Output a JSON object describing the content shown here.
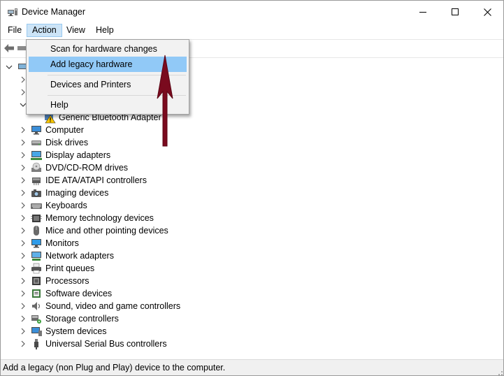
{
  "window": {
    "title": "Device Manager",
    "controls": {
      "minimize": "minimize",
      "maximize": "maximize",
      "close": "close"
    }
  },
  "menubar": {
    "items": [
      {
        "label": "File"
      },
      {
        "label": "Action"
      },
      {
        "label": "View"
      },
      {
        "label": "Help"
      }
    ],
    "active": "Action"
  },
  "action_menu": {
    "items": [
      {
        "label": "Scan for hardware changes"
      },
      {
        "label": "Add legacy hardware",
        "highlighted": true
      },
      {
        "label": "Devices and Printers"
      },
      {
        "label": "Help"
      }
    ]
  },
  "tree": {
    "expanded_child": {
      "label": "Generic Bluetooth Adapter",
      "icon": "warning-icon"
    },
    "categories": [
      {
        "label": "Computer",
        "icon": "computer-icon"
      },
      {
        "label": "Disk drives",
        "icon": "disk-drive-icon"
      },
      {
        "label": "Display adapters",
        "icon": "display-adapter-icon"
      },
      {
        "label": "DVD/CD-ROM drives",
        "icon": "dvd-drive-icon"
      },
      {
        "label": "IDE ATA/ATAPI controllers",
        "icon": "ide-controller-icon"
      },
      {
        "label": "Imaging devices",
        "icon": "camera-icon"
      },
      {
        "label": "Keyboards",
        "icon": "keyboard-icon"
      },
      {
        "label": "Memory technology devices",
        "icon": "memory-icon"
      },
      {
        "label": "Mice and other pointing devices",
        "icon": "mouse-icon"
      },
      {
        "label": "Monitors",
        "icon": "monitor-icon"
      },
      {
        "label": "Network adapters",
        "icon": "network-adapter-icon"
      },
      {
        "label": "Print queues",
        "icon": "printer-icon"
      },
      {
        "label": "Processors",
        "icon": "processor-icon"
      },
      {
        "label": "Software devices",
        "icon": "software-device-icon"
      },
      {
        "label": "Sound, video and game controllers",
        "icon": "speaker-icon"
      },
      {
        "label": "Storage controllers",
        "icon": "storage-controller-icon"
      },
      {
        "label": "System devices",
        "icon": "system-device-icon"
      },
      {
        "label": "Universal Serial Bus controllers",
        "icon": "usb-icon"
      }
    ]
  },
  "statusbar": {
    "text": "Add a legacy (non Plug and Play) device to the computer."
  },
  "colors": {
    "menu_highlight": "#91c9f7",
    "menubar_active": "#cce4f7",
    "annotation_arrow": "#7a0a1e",
    "statusbar_bg": "#f0f0f0"
  }
}
